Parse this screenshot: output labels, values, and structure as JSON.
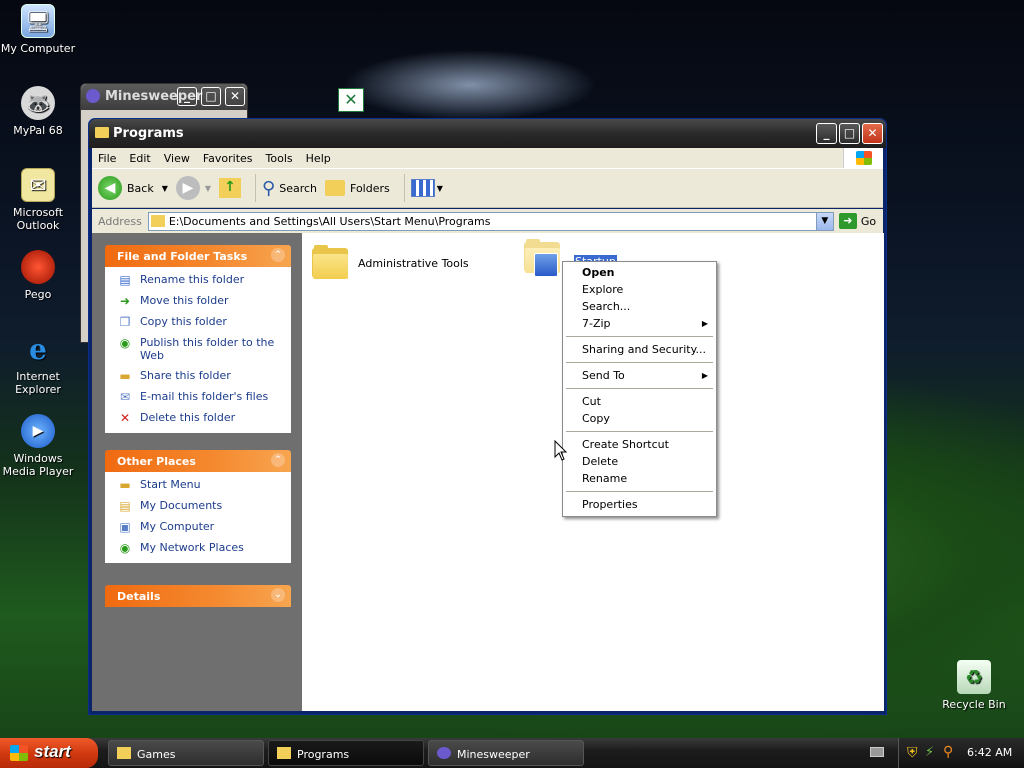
{
  "desktop": {
    "icons": [
      {
        "label": "My Computer"
      },
      {
        "label": "MyPal 68"
      },
      {
        "label": "Microsoft Outlook"
      },
      {
        "label": "Pego"
      },
      {
        "label": "Internet Explorer"
      },
      {
        "label": "Windows Media Player"
      },
      {
        "label": "Recycle Bin"
      }
    ]
  },
  "background_window": {
    "title": "Minesweeper"
  },
  "window": {
    "title": "Programs",
    "menu": [
      "File",
      "Edit",
      "View",
      "Favorites",
      "Tools",
      "Help"
    ],
    "toolbar": {
      "back": "Back",
      "search": "Search",
      "folders": "Folders"
    },
    "address": {
      "label": "Address",
      "value": "E:\\Documents and Settings\\All Users\\Start Menu\\Programs",
      "go": "Go"
    },
    "panels": {
      "file_tasks": {
        "title": "File and Folder Tasks",
        "items": [
          "Rename this folder",
          "Move this folder",
          "Copy this folder",
          "Publish this folder to the Web",
          "Share this folder",
          "E-mail this folder's files",
          "Delete this folder"
        ]
      },
      "other_places": {
        "title": "Other Places",
        "items": [
          "Start Menu",
          "My Documents",
          "My Computer",
          "My Network Places"
        ]
      },
      "details": {
        "title": "Details"
      }
    },
    "items": [
      {
        "name": "Administrative Tools"
      },
      {
        "name": "Startup"
      }
    ]
  },
  "context_menu": {
    "groups": [
      [
        "Open",
        "Explore",
        "Search...",
        "7-Zip"
      ],
      [
        "Sharing and Security..."
      ],
      [
        "Send To"
      ],
      [
        "Cut",
        "Copy"
      ],
      [
        "Create Shortcut",
        "Delete",
        "Rename"
      ],
      [
        "Properties"
      ]
    ]
  },
  "taskbar": {
    "start": "start",
    "buttons": [
      "Games",
      "Programs",
      "Minesweeper"
    ],
    "clock": "6:42 AM"
  }
}
